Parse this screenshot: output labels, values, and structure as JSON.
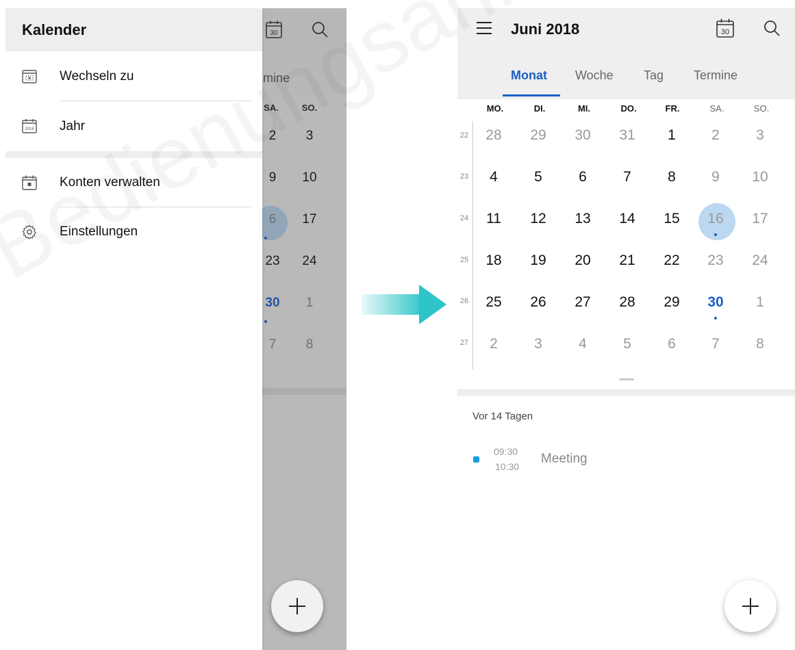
{
  "drawer": {
    "title": "Kalender",
    "items": [
      {
        "label": "Wechseln zu",
        "icon": "calendar-view-icon"
      },
      {
        "label": "Jahr",
        "icon": "calendar-year-icon"
      },
      {
        "label": "Konten verwalten",
        "icon": "calendar-accounts-icon"
      },
      {
        "label": "Einstellungen",
        "icon": "gear-icon"
      }
    ],
    "year_icon_text": "2018"
  },
  "background_calendar": {
    "partial_tab": "mine",
    "day_headers": [
      "SA.",
      "SO."
    ],
    "rows": [
      [
        "2",
        "3"
      ],
      [
        "9",
        "10"
      ],
      [
        "6",
        "17"
      ],
      [
        "23",
        "24"
      ],
      [
        "30",
        "1"
      ],
      [
        "7",
        "8"
      ]
    ],
    "today_icon_number": "30"
  },
  "calendar": {
    "month_title": "Juni 2018",
    "today_icon_number": "30",
    "tabs": [
      "Monat",
      "Woche",
      "Tag",
      "Termine"
    ],
    "active_tab": "Monat",
    "weekdays": [
      "MO.",
      "DI.",
      "MI.",
      "DO.",
      "FR.",
      "SA.",
      "SO."
    ],
    "week_numbers": [
      "22",
      "23",
      "24",
      "25",
      "26",
      "27"
    ],
    "weeks": [
      [
        "28",
        "29",
        "30",
        "31",
        "1",
        "2",
        "3"
      ],
      [
        "4",
        "5",
        "6",
        "7",
        "8",
        "9",
        "10"
      ],
      [
        "11",
        "12",
        "13",
        "14",
        "15",
        "16",
        "17"
      ],
      [
        "18",
        "19",
        "20",
        "21",
        "22",
        "23",
        "24"
      ],
      [
        "25",
        "26",
        "27",
        "28",
        "29",
        "30",
        "1"
      ],
      [
        "2",
        "3",
        "4",
        "5",
        "6",
        "7",
        "8"
      ]
    ],
    "selected_day": "16",
    "today": "30",
    "days_with_events": [
      "16",
      "30"
    ]
  },
  "agenda": {
    "heading": "Vor 14 Tagen",
    "events": [
      {
        "start": "09:30",
        "end": "10:30",
        "title": "Meeting",
        "color": "#1a9de0"
      }
    ]
  },
  "colors": {
    "accent": "#1a5fc4",
    "selection": "#bcd7f0",
    "arrow": "#2ec4c8"
  },
  "watermark": "Bedienungsanleitu"
}
